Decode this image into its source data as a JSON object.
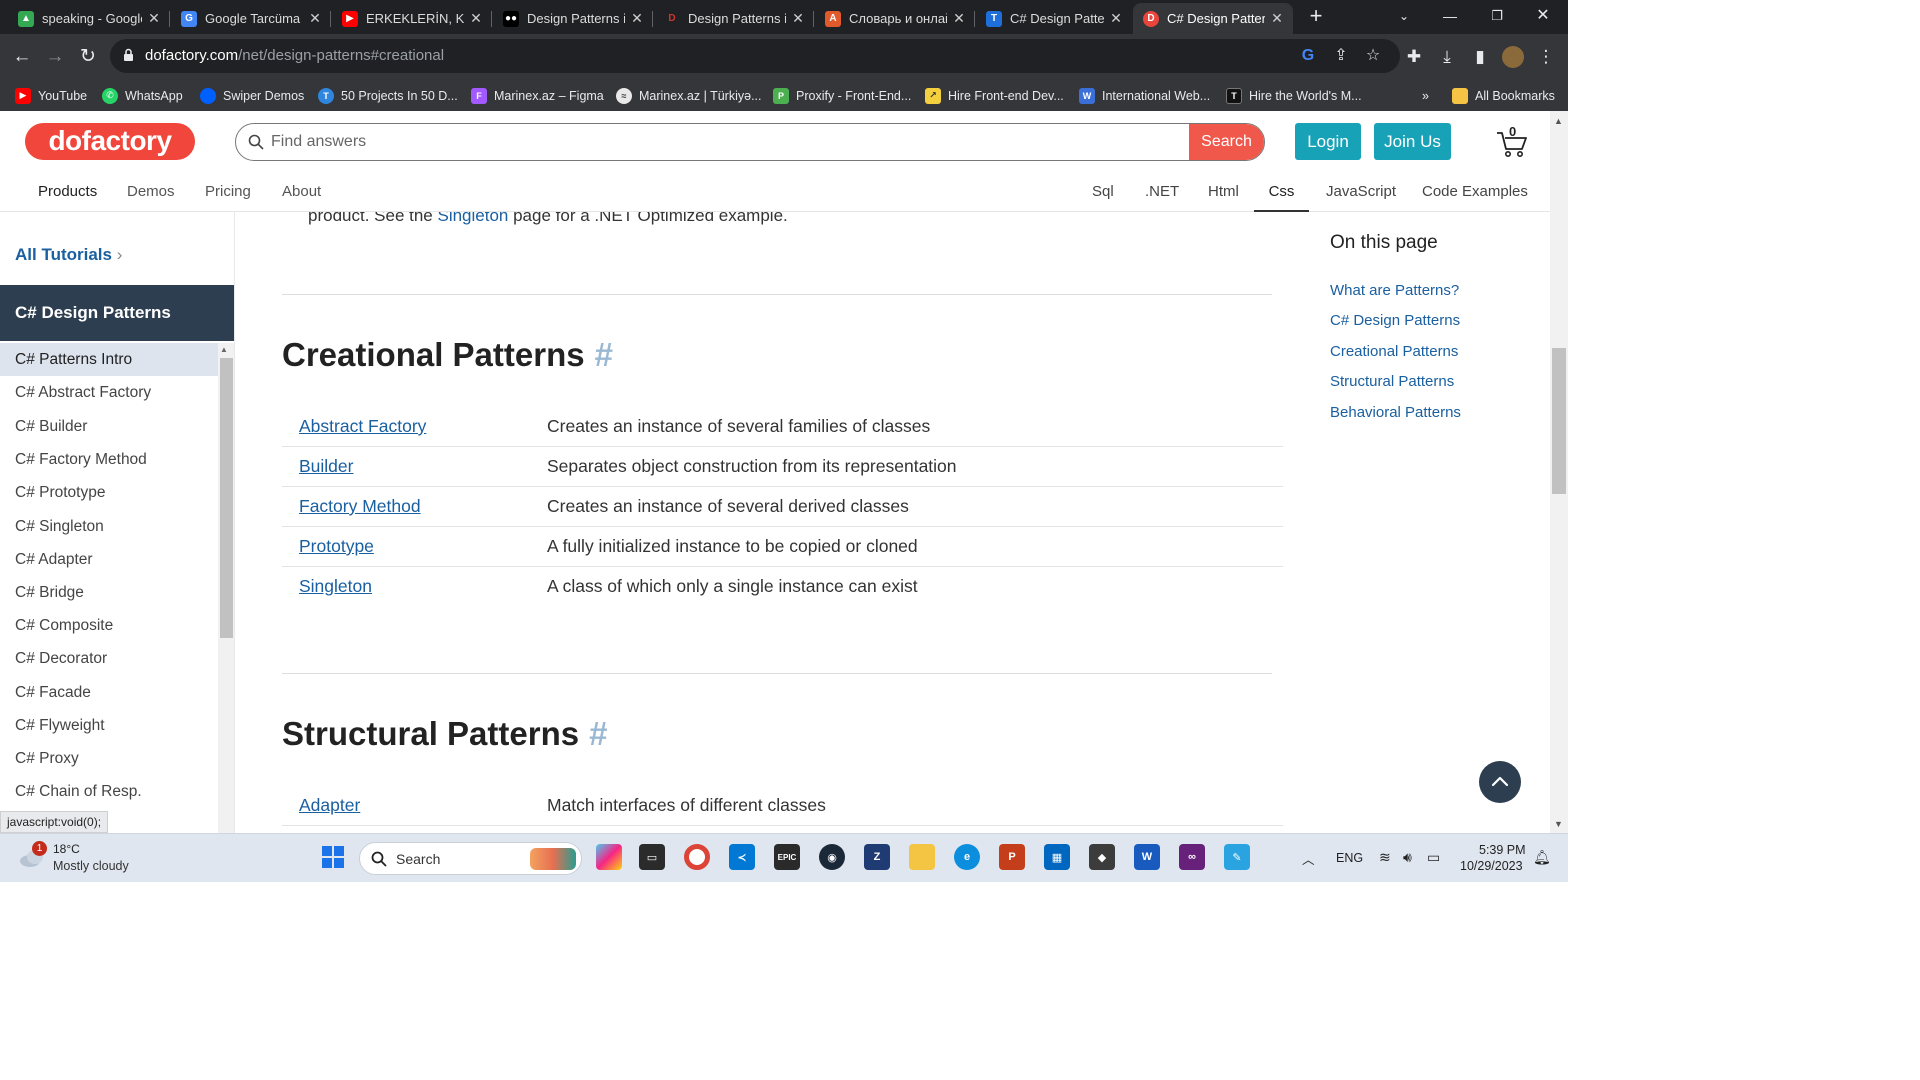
{
  "browser": {
    "tabs": [
      {
        "label": "speaking - Google",
        "icon": "google-drive-icon",
        "color": "#34a853"
      },
      {
        "label": "Google Tarcüma",
        "icon": "google-translate-icon",
        "color": "#4285f4"
      },
      {
        "label": "ERKEKLERİN, KA",
        "icon": "youtube-icon",
        "color": "#ff0000"
      },
      {
        "label": "Design Patterns i",
        "icon": "medium-icon",
        "color": "#000000"
      },
      {
        "label": "Design Patterns i",
        "icon": "dofactory-icon",
        "color": "#d0352b"
      },
      {
        "label": "Словарь и онлай",
        "icon": "dictionary-icon",
        "color": "#e05a2b"
      },
      {
        "label": "C# Design Patter",
        "icon": "tutorialsteacher-icon",
        "color": "#1e6fd9"
      },
      {
        "label": "C# Design Patter",
        "icon": "dofactory-icon",
        "color": "#e8453c"
      }
    ],
    "url": "dofactory.com",
    "url_path": "/net/design-patterns#creational",
    "bookmarks": [
      {
        "label": "YouTube",
        "color": "#ff0000"
      },
      {
        "label": "WhatsApp",
        "color": "#25d366"
      },
      {
        "label": "Swiper Demos",
        "color": "#0060ff"
      },
      {
        "label": "50 Projects In 50 D...",
        "color": "#2e86de"
      },
      {
        "label": "Marinex.az – Figma",
        "color": "#a259ff"
      },
      {
        "label": "Marinex.az | Türkiyə...",
        "color": "#e8e8e8"
      },
      {
        "label": "Proxify - Front-End...",
        "color": "#4caf50"
      },
      {
        "label": "Hire Front-end Dev...",
        "color": "#f4d03f"
      },
      {
        "label": "International Web...",
        "color": "#3a6fd8"
      },
      {
        "label": "Hire the World's M...",
        "color": "#111111"
      }
    ],
    "more_bookmarks": "»",
    "all_bookmarks": "All Bookmarks"
  },
  "site": {
    "logo": "dofactory",
    "search_placeholder": "Find answers",
    "search_button": "Search",
    "login": "Login",
    "join": "Join Us",
    "cart_count": "0",
    "nav_left": [
      "Products",
      "Demos",
      "Pricing",
      "About"
    ],
    "nav_right": [
      "Sql",
      ".NET",
      "Html",
      "Css",
      "JavaScript",
      "Code Examples"
    ],
    "active_tab": "Css",
    "brand_color": "#f0463c",
    "accent_color": "#17a2b8"
  },
  "sidebar": {
    "all_tutorials": "All Tutorials",
    "heading": "C# Design Patterns",
    "items": [
      "C# Patterns Intro",
      "C# Abstract Factory",
      "C# Builder",
      "C# Factory Method",
      "C# Prototype",
      "C# Singleton",
      "C# Adapter",
      "C# Bridge",
      "C# Composite",
      "C# Decorator",
      "C# Facade",
      "C# Flyweight",
      "C# Proxy",
      "C# Chain of Resp."
    ],
    "active_item": "C# Patterns Intro"
  },
  "main": {
    "cut_text_before": "product. See the ",
    "cut_text_link": "Singleton",
    "cut_text_after": " page for a .NET Optimized example.",
    "hash": "#",
    "creational": {
      "title": "Creational Patterns",
      "rows": [
        {
          "name": "Abstract Factory",
          "desc": "Creates an instance of several families of classes"
        },
        {
          "name": "Builder",
          "desc": "Separates object construction from its representation"
        },
        {
          "name": "Factory Method",
          "desc": "Creates an instance of several derived classes"
        },
        {
          "name": "Prototype",
          "desc": "A fully initialized instance to be copied or cloned"
        },
        {
          "name": "Singleton",
          "desc": "A class of which only a single instance can exist"
        }
      ]
    },
    "structural": {
      "title": "Structural Patterns",
      "rows": [
        {
          "name": "Adapter",
          "desc": "Match interfaces of different classes"
        }
      ]
    }
  },
  "toc": {
    "title": "On this page",
    "items": [
      "What are Patterns?",
      "C# Design Patterns",
      "Creational Patterns",
      "Structural Patterns",
      "Behavioral Patterns"
    ]
  },
  "status_bar": "javascript:void(0);",
  "taskbar": {
    "weather_badge": "1",
    "temperature": "18°C",
    "weather": "Mostly cloudy",
    "search_label": "Search",
    "language": "ENG",
    "time": "5:39 PM",
    "date": "10/29/2023"
  }
}
